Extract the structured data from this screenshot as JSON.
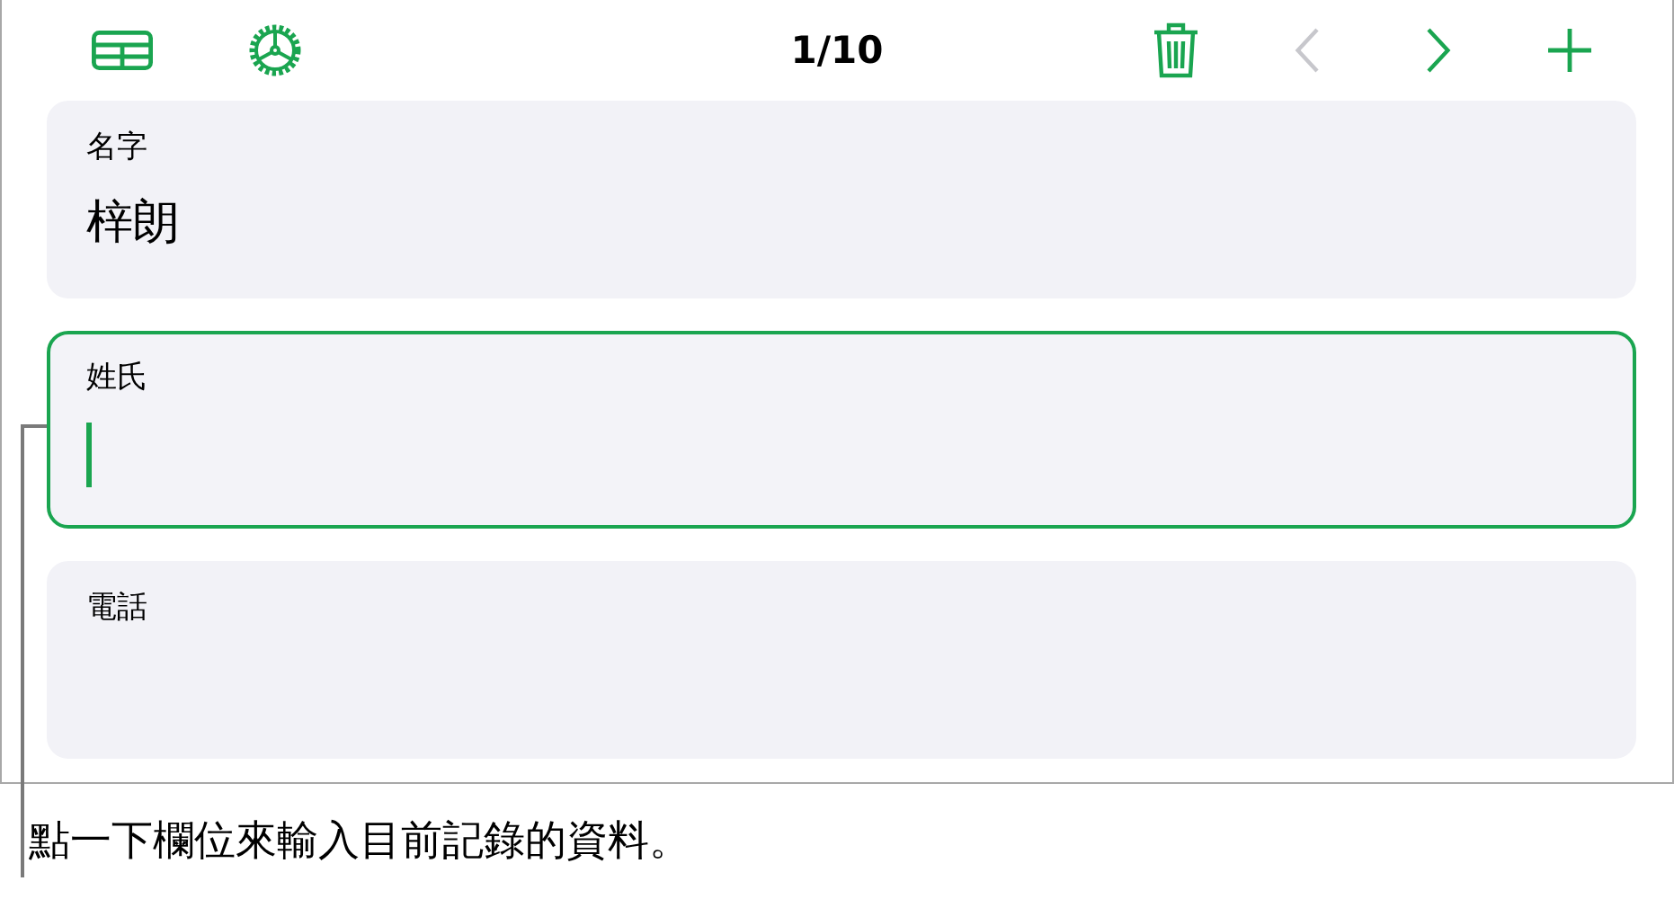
{
  "toolbar": {
    "left_buttons": [
      {
        "kind": "table",
        "disabled": false
      },
      {
        "kind": "settings",
        "disabled": false
      }
    ],
    "record_counter": "1/10",
    "right_buttons": [
      {
        "kind": "delete",
        "disabled": false
      },
      {
        "kind": "previous",
        "disabled": true
      },
      {
        "kind": "next",
        "disabled": false
      },
      {
        "kind": "add",
        "disabled": false
      }
    ]
  },
  "fields": [
    {
      "label": "名字",
      "value": "梓朗",
      "focused": false
    },
    {
      "label": "姓氏",
      "focused": true
    },
    {
      "label": "電話",
      "focused": false
    }
  ],
  "caption": "點一下欄位來輸入目前記錄的資料。"
}
